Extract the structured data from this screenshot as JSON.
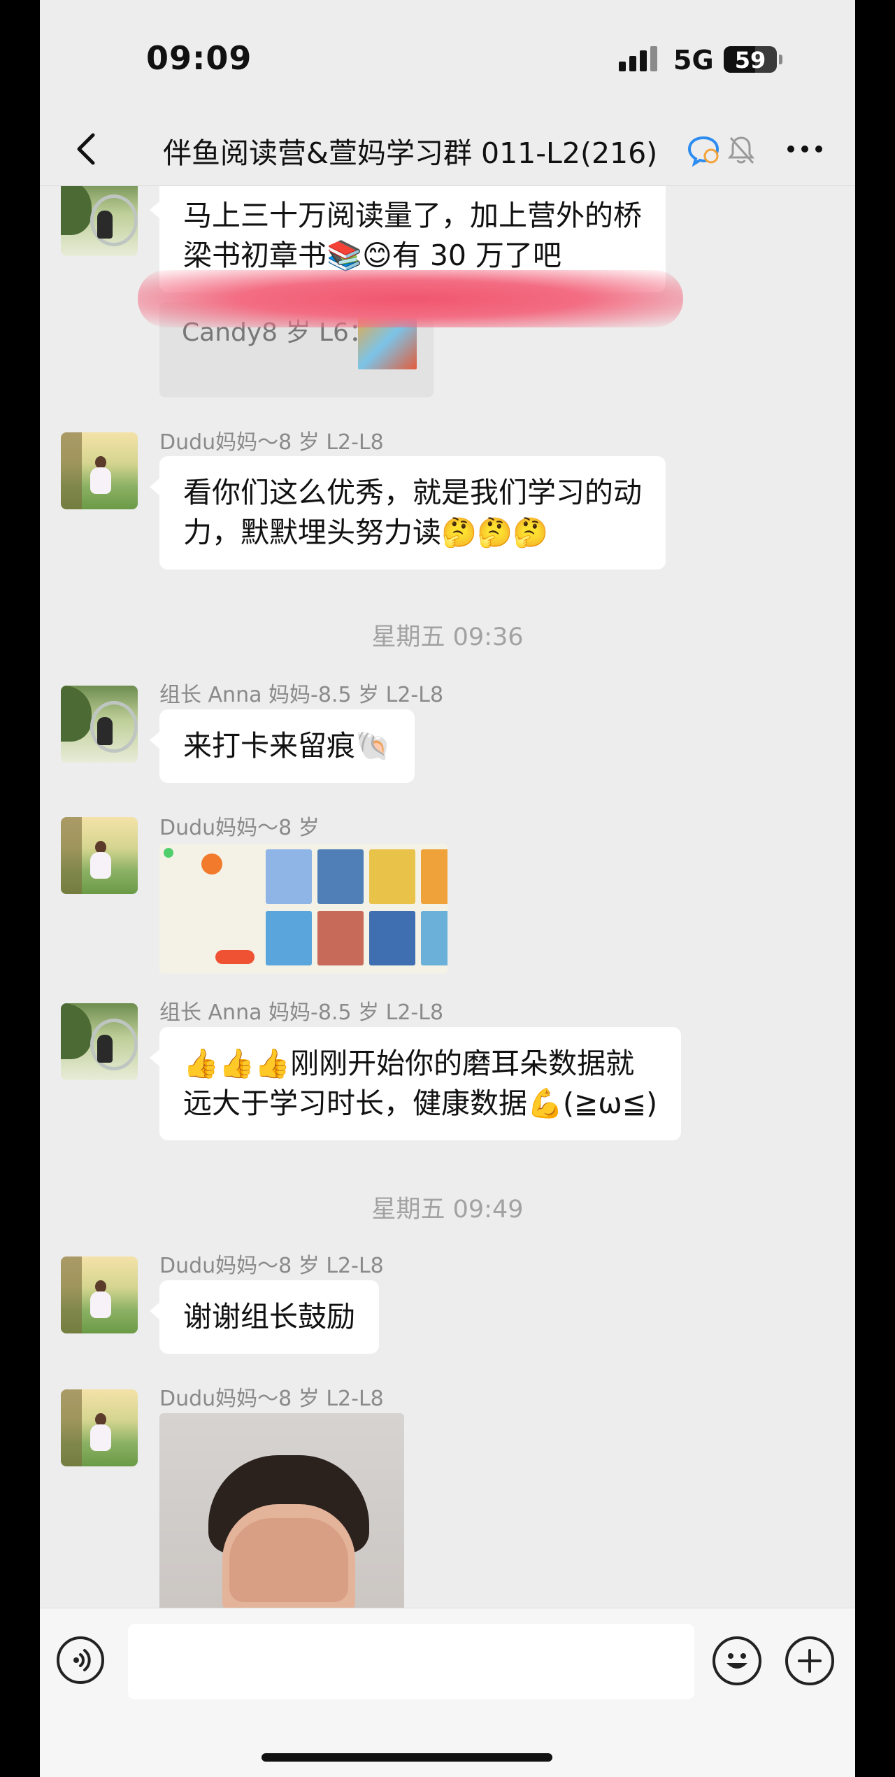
{
  "status_bar": {
    "time": "09:09",
    "network": "5G",
    "battery": "59",
    "battery_level": 0.59
  },
  "header": {
    "title": "伴鱼阅读营&萱妈学习群 011-L2(216)",
    "icons": [
      "back-icon",
      "chat-tag-icon",
      "mute-bell-icon",
      "more-icon"
    ]
  },
  "messages": {
    "m1": {
      "text_line1": "马上三十万阅读量了，加上营外的桥",
      "text_line2": "梁书初章书📚😊有 30 万了吧",
      "quote": "Candy8 岁 L6："
    },
    "m2": {
      "sender": "Dudu妈妈～8 岁 L2-L8",
      "text_line1": "看你们这么优秀，就是我们学习的动",
      "text_line2": "力，默默埋头努力读🤔🤔🤔"
    },
    "t1": "星期五 09:36",
    "m3": {
      "sender": "组长 Anna 妈妈-8.5 岁 L2-L8",
      "text": "来打卡来留痕🐚"
    },
    "m4": {
      "sender": "Dudu妈妈～8 岁"
    },
    "m5": {
      "sender": "组长 Anna 妈妈-8.5 岁 L2-L8",
      "text_line1": "👍👍👍刚刚开始你的磨耳朵数据就",
      "text_line2": "远大于学习时长，健康数据💪(≧ω≦)"
    },
    "t2": "星期五 09:49",
    "m6": {
      "sender": "Dudu妈妈～8 岁 L2-L8",
      "text": "谢谢组长鼓励"
    },
    "m7": {
      "sender": "Dudu妈妈～8 岁 L2-L8"
    }
  },
  "input_bar": {
    "icons": [
      "voice-icon",
      "emoji-icon",
      "plus-icon"
    ],
    "value": ""
  },
  "colors": {
    "background": "#ededed",
    "bubble": "#ffffff",
    "redact": "#f36d83"
  }
}
